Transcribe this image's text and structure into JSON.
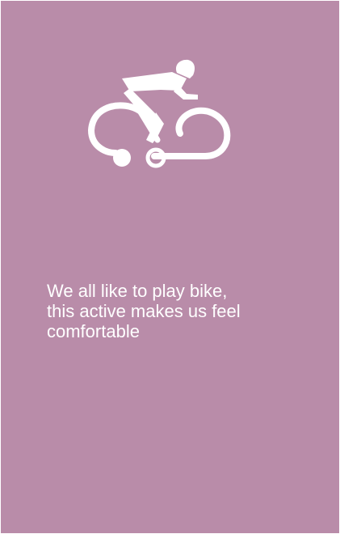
{
  "card": {
    "background_color": "#b98ca9",
    "icon": "cyclist-icon",
    "icon_color": "#ffffff",
    "caption_lines": [
      "We all like to play bike,",
      "this active makes us feel",
      "comfortable"
    ]
  }
}
